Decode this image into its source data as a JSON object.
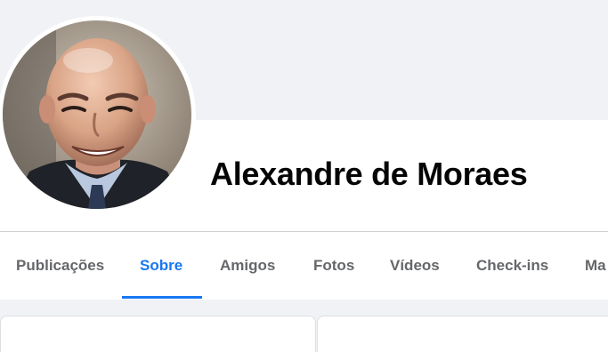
{
  "profile": {
    "name": "Alexandre de Moraes",
    "avatar_alt": "Alexandre de Moraes"
  },
  "tabs": [
    {
      "label": "Publicações",
      "active": false
    },
    {
      "label": "Sobre",
      "active": true
    },
    {
      "label": "Amigos",
      "active": false
    },
    {
      "label": "Fotos",
      "active": false
    },
    {
      "label": "Vídeos",
      "active": false
    },
    {
      "label": "Check-ins",
      "active": false
    },
    {
      "label": "Ma",
      "active": false
    }
  ],
  "colors": {
    "accent": "#1877f2",
    "tab_text": "#65676b",
    "name_text": "#050505",
    "background": "#f0f2f5"
  }
}
